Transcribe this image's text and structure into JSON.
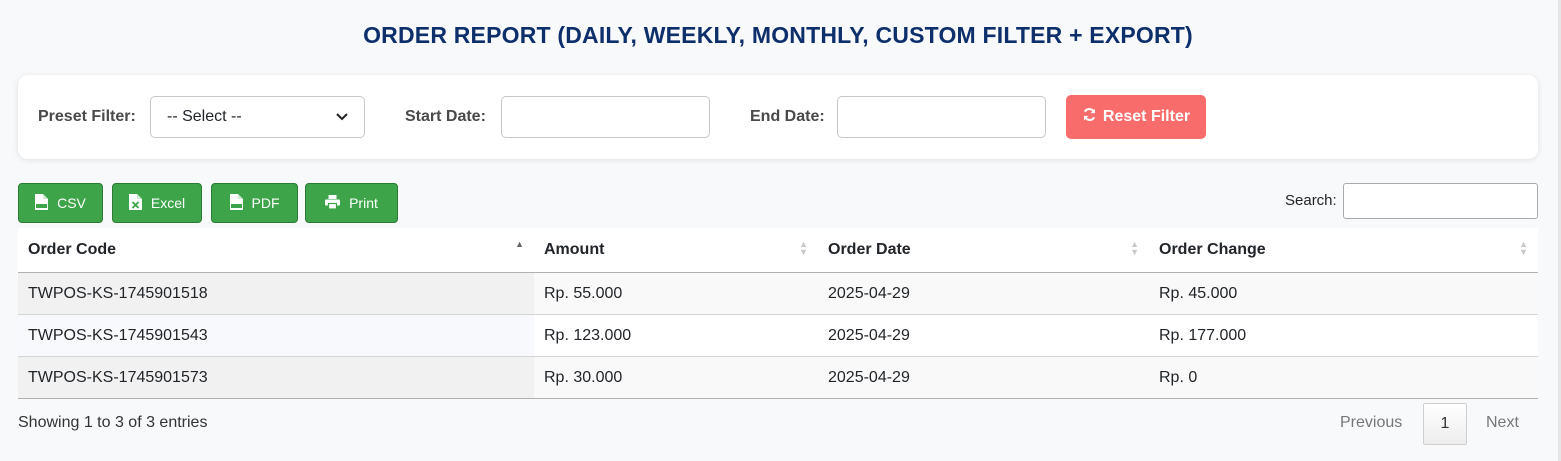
{
  "title": "ORDER REPORT (DAILY, WEEKLY, MONTHLY, CUSTOM FILTER + EXPORT)",
  "filters": {
    "preset_label": "Preset Filter:",
    "preset_value": "-- Select --",
    "start_label": "Start Date:",
    "start_value": "",
    "end_label": "End Date:",
    "end_value": "",
    "reset_label": "Reset Filter"
  },
  "export": {
    "csv": "CSV",
    "excel": "Excel",
    "pdf": "PDF",
    "print": "Print"
  },
  "search": {
    "label": "Search:",
    "value": ""
  },
  "table": {
    "columns": [
      "Order Code",
      "Amount",
      "Order Date",
      "Order Change"
    ],
    "rows": [
      [
        "TWPOS-KS-1745901518",
        "Rp. 55.000",
        "2025-04-29",
        "Rp. 45.000"
      ],
      [
        "TWPOS-KS-1745901543",
        "Rp. 123.000",
        "2025-04-29",
        "Rp. 177.000"
      ],
      [
        "TWPOS-KS-1745901573",
        "Rp. 30.000",
        "2025-04-29",
        "Rp. 0"
      ]
    ]
  },
  "footer": {
    "info": "Showing 1 to 3 of 3 entries",
    "previous": "Previous",
    "current_page": "1",
    "next": "Next"
  },
  "colors": {
    "title": "#0d2f6b",
    "export_green": "#3ea44a",
    "reset_red": "#f86c6b"
  }
}
